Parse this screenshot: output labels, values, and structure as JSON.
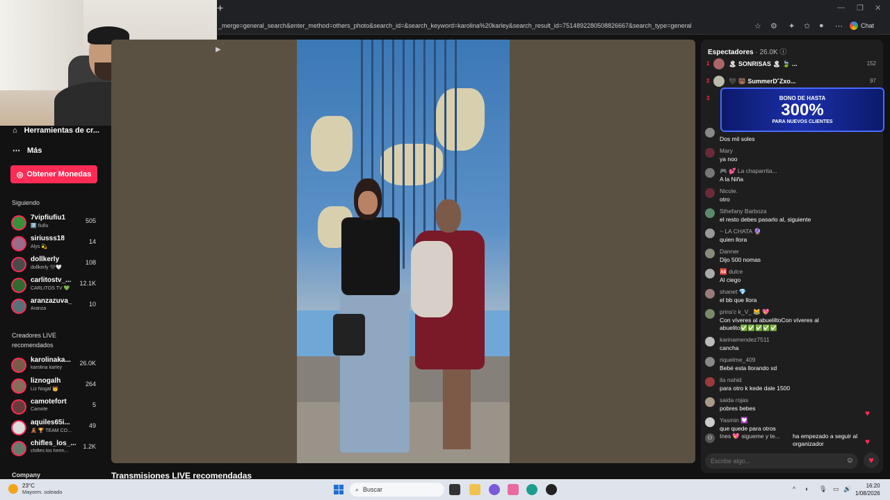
{
  "browser": {
    "url": "_merge=general_search&enter_method=others_photo&search_id=&search_keyword=karolina%20karley&search_result_id=7514892280508826667&search_type=general",
    "chat_label": "Chat"
  },
  "nav": {
    "tools_label": "Herramientas de cr...",
    "more_label": "Más",
    "coins_label": "Obtener Monedas"
  },
  "following": {
    "title": "Siguiendo",
    "items": [
      {
        "name": "7vipfiufiu1",
        "sub": "7️⃣ fiufiu",
        "count": "505"
      },
      {
        "name": "siriusss18",
        "sub": "Alys 💫",
        "count": "14"
      },
      {
        "name": "dollkerly",
        "sub": "dollkerly 🖤🤍",
        "count": "108"
      },
      {
        "name": "carlitostv_...",
        "sub": "CARLITOS TV 💚",
        "count": "12.1K"
      },
      {
        "name": "aranzazuva_",
        "sub": "Aranza",
        "count": "10"
      }
    ]
  },
  "recommended": {
    "title": "Creadores LIVE recomendados",
    "items": [
      {
        "name": "karolinaka...",
        "sub": "karolina karley",
        "count": "26.0K"
      },
      {
        "name": "liznogalh",
        "sub": "Liz Nogal 👑",
        "count": "264"
      },
      {
        "name": "camotefort",
        "sub": "Camote",
        "count": "5"
      },
      {
        "name": "aquiles65i...",
        "sub": "🧸 🏆 TEAM CO...",
        "count": "49"
      },
      {
        "name": "chifles_los_...",
        "sub": "chifles los herm...",
        "count": "1.2K"
      }
    ]
  },
  "company_label": "Company",
  "recommended_live_heading": "Transmisiones LIVE recomendadas",
  "chat": {
    "viewers_label": "Espectadores",
    "viewers_count": "· 26.0K",
    "ranking": [
      {
        "rank": "1",
        "name": "🏝 SONRISAS 🏝 🍃 ...",
        "score": "152"
      },
      {
        "rank": "2",
        "name": "🖤 🐻 SummerD˚Zxo...",
        "score": "97"
      },
      {
        "rank": "3",
        "name": "",
        "score": ""
      }
    ],
    "ad": {
      "line1": "BONO DE HASTA",
      "line2": "300%",
      "line3": "PARA NUEVOS CLIENTES"
    },
    "messages": [
      {
        "user": "",
        "text": "Dos mil soles"
      },
      {
        "user": "Mary",
        "text": "ya noo"
      },
      {
        "user": "🎮 💕 La chaparrita...",
        "text": "A la Niña"
      },
      {
        "user": "Nicole.",
        "text": "otro"
      },
      {
        "user": "Sthefany Barboza",
        "text": "el resto debes pasarlo al, siguiente"
      },
      {
        "user": "~ LA CHATA 🔮",
        "text": "quien llora"
      },
      {
        "user": "Danner",
        "text": "Dijo 500 nomas"
      },
      {
        "user": "🆎 dulce",
        "text": "Al ciego"
      },
      {
        "user": "shanet 💎",
        "text": "el bb que llora"
      },
      {
        "user": "prins'c k_V_ 😹 💖",
        "text": "Con víveres al abueliltoCon víveres al abuelito✅✅✅✅✅"
      },
      {
        "user": "karinamendez7511",
        "text": "cancha"
      },
      {
        "user": "riquelme_409",
        "text": "Bebé esta llorando xd"
      },
      {
        "user": "ila nahid",
        "text": "para otro k kede dale 1500"
      },
      {
        "user": "saida rojas",
        "text": "pobres bebes"
      },
      {
        "user": "Yasmin 💟",
        "text": "que quede para otros"
      }
    ],
    "follow_notice": {
      "user": "Ines 💖 sigueme y te...",
      "text": "ha empezado a seguir al organizador"
    },
    "input_placeholder": "Escribe algo..."
  },
  "taskbar": {
    "temp": "23°C",
    "weather": "Mayorm. soleado",
    "search_label": "Buscar",
    "time": "16:20",
    "date": "1/08/2026"
  }
}
